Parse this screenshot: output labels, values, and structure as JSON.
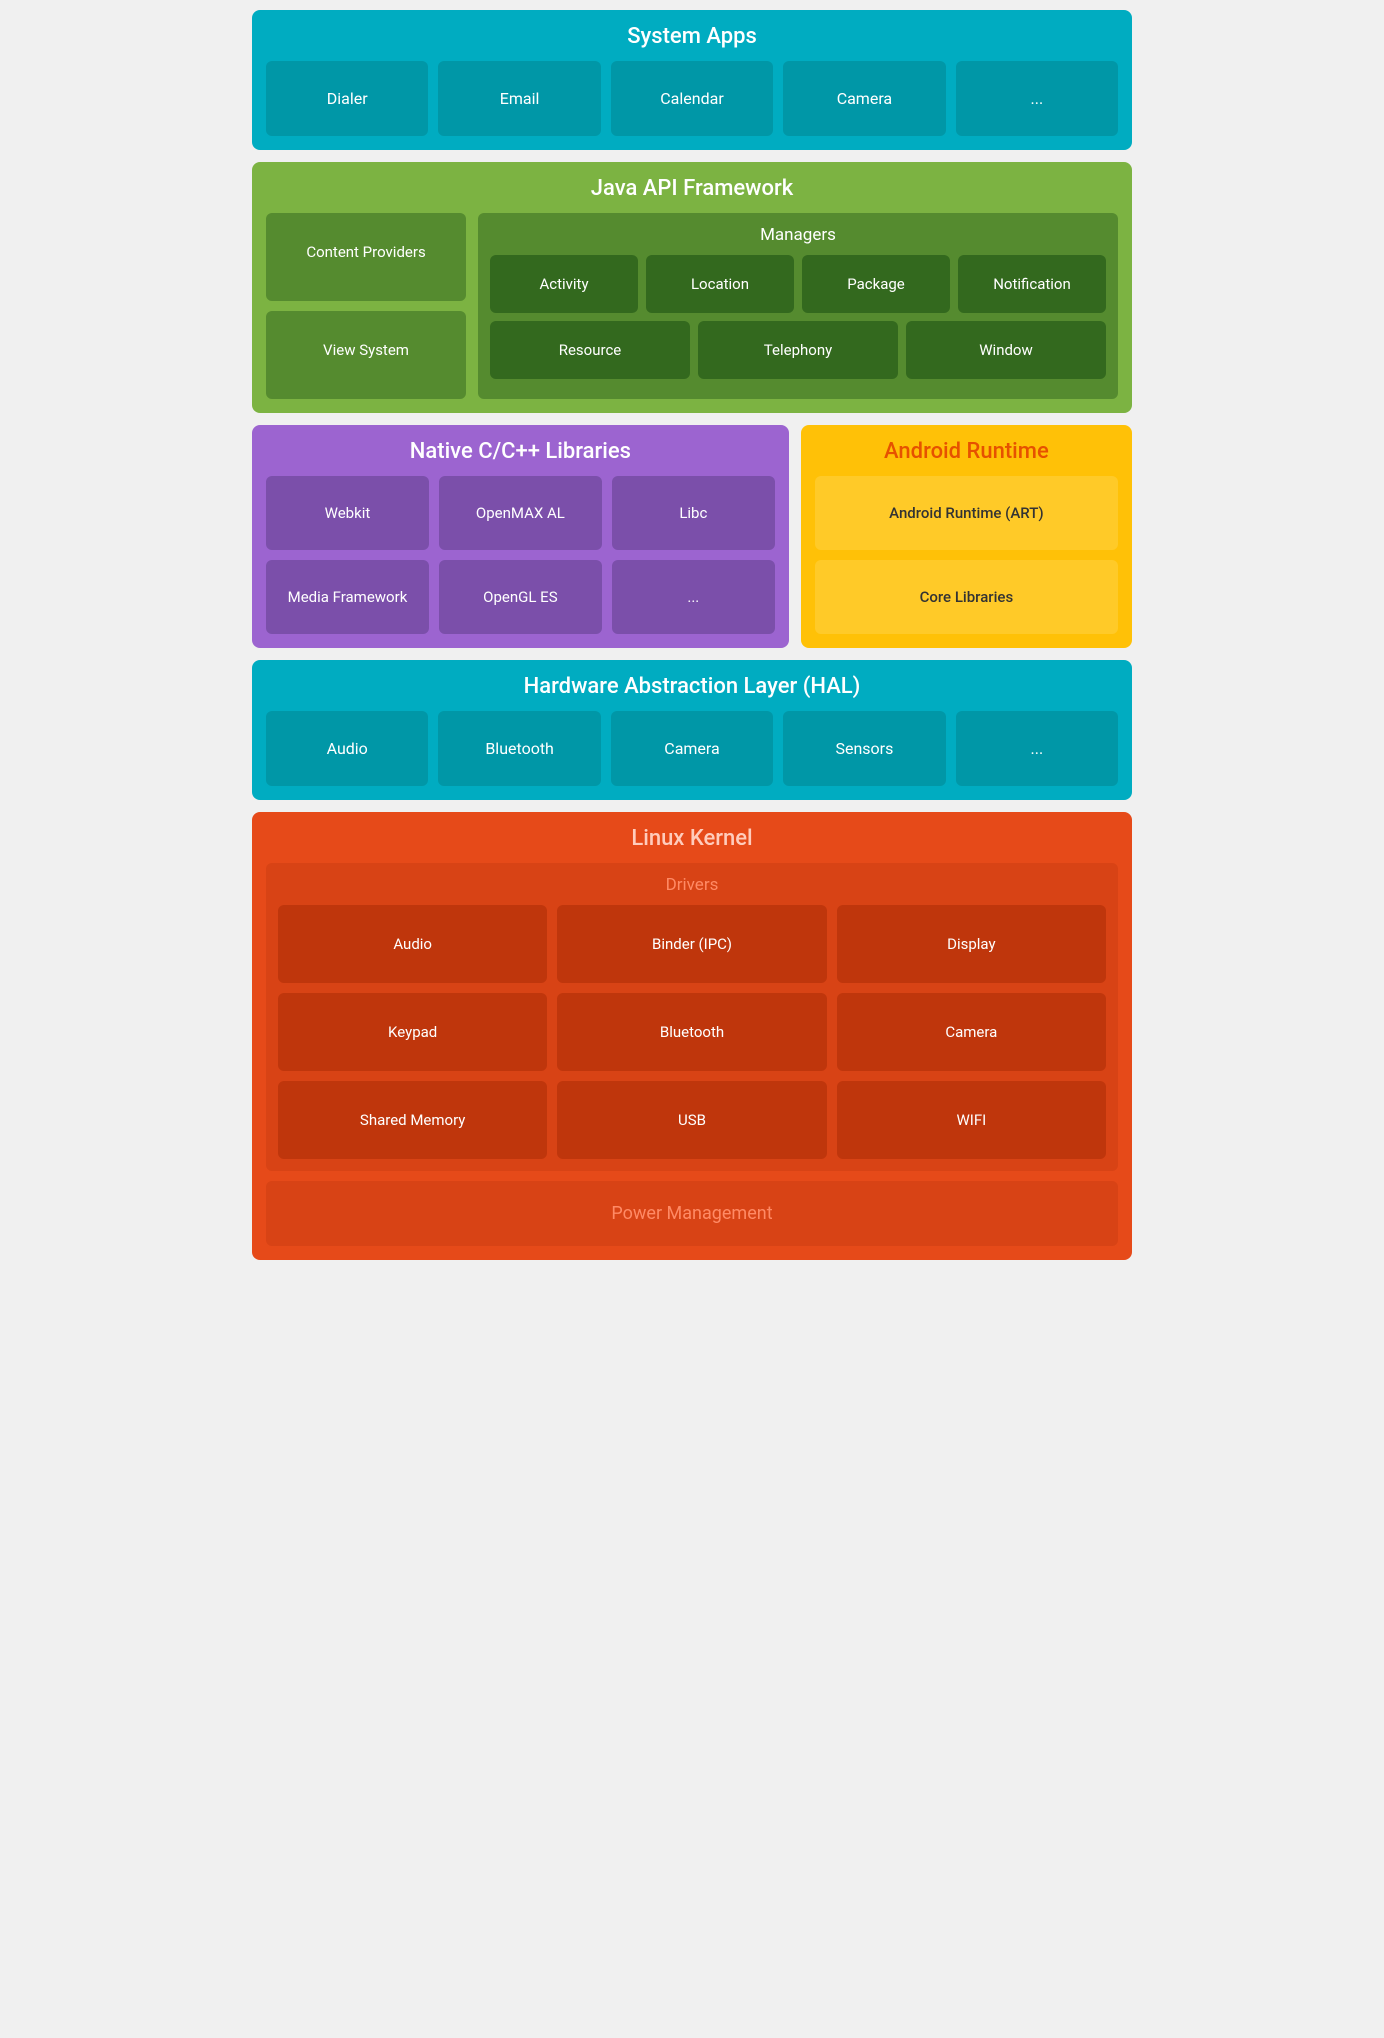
{
  "systemApps": {
    "title": "System Apps",
    "items": [
      "Dialer",
      "Email",
      "Calendar",
      "Camera",
      "..."
    ]
  },
  "javaApi": {
    "title": "Java API Framework",
    "leftItems": [
      "Content Providers",
      "View System"
    ],
    "managers": {
      "title": "Managers",
      "row1": [
        "Activity",
        "Location",
        "Package",
        "Notification"
      ],
      "row2": [
        "Resource",
        "Telephony",
        "Window"
      ]
    }
  },
  "nativeLibs": {
    "title": "Native C/C++ Libraries",
    "items": [
      "Webkit",
      "OpenMAX AL",
      "Libc",
      "Media Framework",
      "OpenGL ES",
      "..."
    ]
  },
  "androidRuntime": {
    "title": "Android Runtime",
    "items": [
      "Android Runtime (ART)",
      "Core Libraries"
    ]
  },
  "hal": {
    "title": "Hardware Abstraction Layer (HAL)",
    "items": [
      "Audio",
      "Bluetooth",
      "Camera",
      "Sensors",
      "..."
    ]
  },
  "linuxKernel": {
    "title": "Linux Kernel",
    "drivers": {
      "title": "Drivers",
      "items": [
        "Audio",
        "Binder (IPC)",
        "Display",
        "Keypad",
        "Bluetooth",
        "Camera",
        "Shared Memory",
        "USB",
        "WIFI"
      ]
    },
    "powerManagement": "Power Management"
  }
}
